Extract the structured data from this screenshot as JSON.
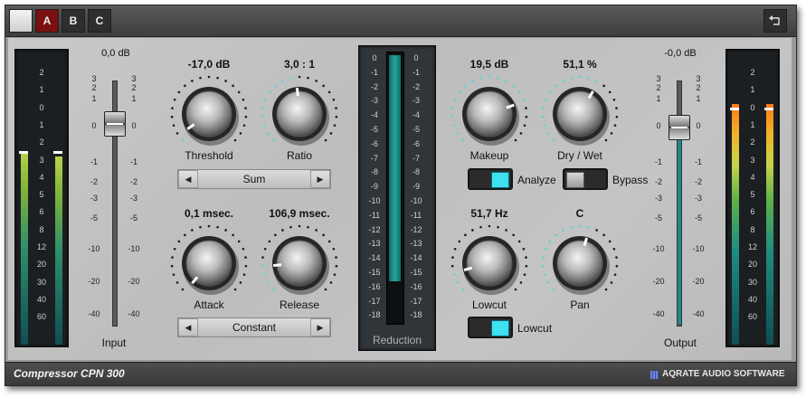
{
  "topbar": {
    "presets": [
      "A",
      "B",
      "C"
    ],
    "back_icon": "return-arrow-icon"
  },
  "footer": {
    "title": "Compressor CPN 300",
    "brand": "AQRATE AUDIO SOFTWARE"
  },
  "input": {
    "value": "0,0 dB",
    "label": "Input",
    "fader_ticks": [
      "3",
      "2",
      "1",
      "0",
      "-1",
      "-2",
      "-3",
      "-5",
      "-10",
      "-20",
      "-40"
    ],
    "meter_ticks": [
      "2",
      "1",
      "0",
      "1",
      "2",
      "3",
      "4",
      "5",
      "6",
      "8",
      "12",
      "20",
      "30",
      "40",
      "60"
    ]
  },
  "output": {
    "value": "-0,0 dB",
    "label": "Output",
    "fader_ticks": [
      "3",
      "2",
      "1",
      "0",
      "-1",
      "-2",
      "-3",
      "-5",
      "-10",
      "-20",
      "-40"
    ],
    "meter_ticks": [
      "2",
      "1",
      "0",
      "1",
      "2",
      "3",
      "4",
      "5",
      "6",
      "8",
      "12",
      "20",
      "30",
      "40",
      "60"
    ]
  },
  "reduction": {
    "label": "Reduction",
    "ticks": [
      "0",
      "-1",
      "-2",
      "-3",
      "-4",
      "-5",
      "-6",
      "-7",
      "-8",
      "-9",
      "-10",
      "-11",
      "-12",
      "-13",
      "-14",
      "-15",
      "-16",
      "-17",
      "-18"
    ]
  },
  "knobs": {
    "threshold": {
      "label": "Threshold",
      "value": "-17,0 dB"
    },
    "ratio": {
      "label": "Ratio",
      "value": "3,0 : 1"
    },
    "attack": {
      "label": "Attack",
      "value": "0,1 msec."
    },
    "release": {
      "label": "Release",
      "value": "106,9 msec."
    },
    "makeup": {
      "label": "Makeup",
      "value": "19,5 dB"
    },
    "drywet": {
      "label": "Dry / Wet",
      "value": "51,1 %"
    },
    "lowcut": {
      "label": "Lowcut",
      "value": "51,7 Hz"
    },
    "pan": {
      "label": "Pan",
      "value": "C"
    }
  },
  "selectors": {
    "detection": {
      "value": "Sum"
    },
    "mode": {
      "value": "Constant"
    }
  },
  "toggles": {
    "analyze": {
      "label": "Analyze",
      "on": true
    },
    "bypass": {
      "label": "Bypass",
      "on": false
    },
    "lowcut": {
      "label": "Lowcut",
      "on": true
    }
  },
  "colors": {
    "accent": "#3fe0f0",
    "meter_teal": "#1e8a86",
    "preset_active": "#7a1010"
  }
}
